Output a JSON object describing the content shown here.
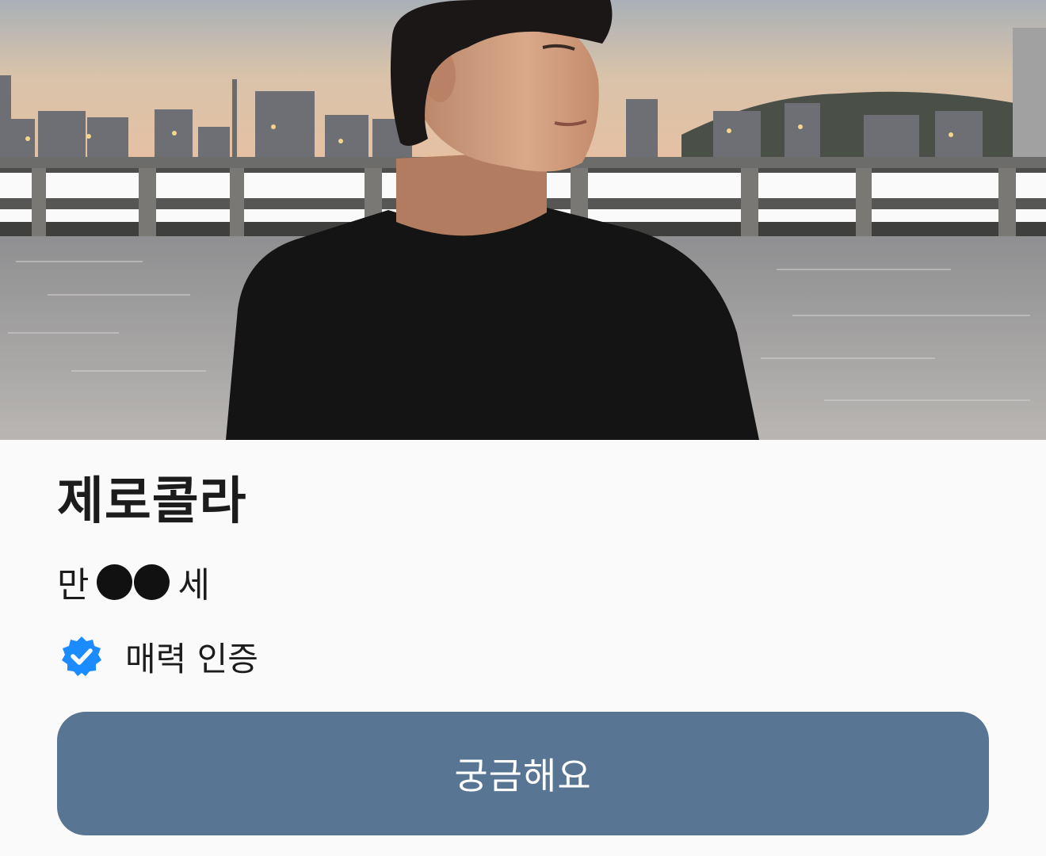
{
  "profile": {
    "name": "제로콜라",
    "age_prefix": "만",
    "age_suffix": "세",
    "verification_label": "매력 인증",
    "photo_icon": "profile-photo"
  },
  "actions": {
    "curious_label": "궁금해요"
  },
  "colors": {
    "button": "#587593",
    "badge": "#1a8cff",
    "text": "#1c1c1c",
    "background": "#fafafa"
  }
}
